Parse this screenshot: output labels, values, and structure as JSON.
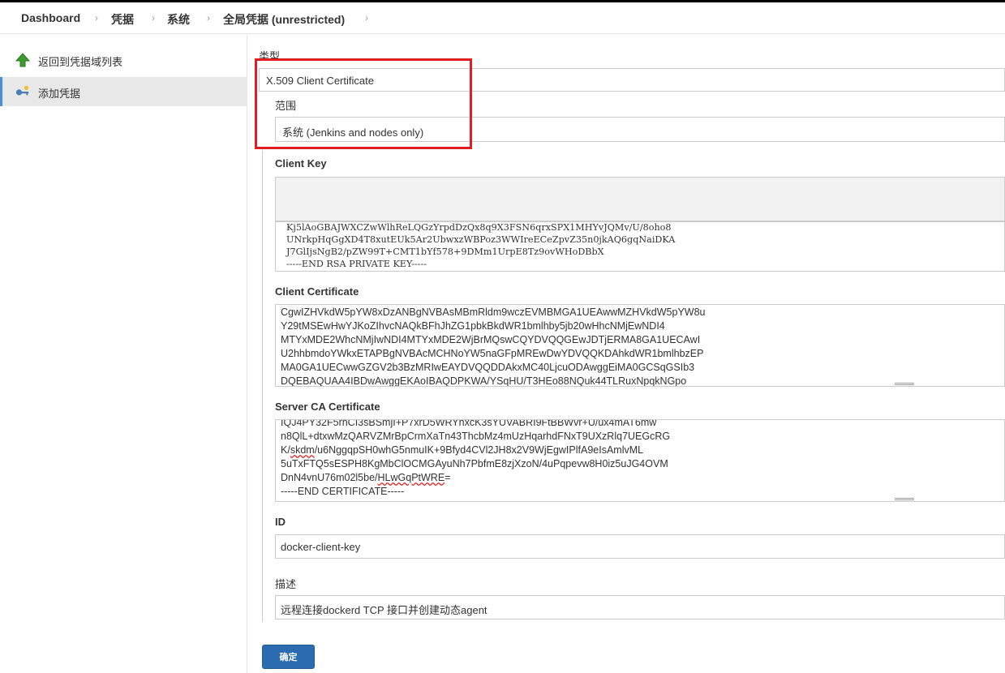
{
  "breadcrumb": {
    "items": [
      "Dashboard",
      "凭据",
      "系统",
      "全局凭据 (unrestricted)"
    ]
  },
  "sidebar": {
    "items": [
      {
        "label": "返回到凭据域列表",
        "icon": "up-arrow-icon"
      },
      {
        "label": "添加凭据",
        "icon": "key-add-icon"
      }
    ]
  },
  "form": {
    "kind_label": "类型",
    "kind_value": "X.509 Client Certificate",
    "scope_label": "范围",
    "scope_value": "系统 (Jenkins and nodes only)",
    "client_key_label": "Client Key",
    "client_key_lines": [
      "Kj5lAoGBAJWXCZwWlhReLQGzYrpdDzQx8q9X3FSN6qrxSPX1MHYvJQMv/U/8oho8",
      "UNrkpHqGgXD4T8xutEUk5Ar2UbwxzWBPoz3WWIreECeZpvZ35n0jkAQ6gqNaiDKA",
      "J7GlIjsNgB2/pZW99T+CMT1bYf578+9DMm1UrpE8Tz9ovWHoDBbX",
      "-----END RSA PRIVATE KEY-----"
    ],
    "client_cert_label": "Client Certificate",
    "client_cert_lines": [
      "CgwIZHVkdW5pYW8xDzANBgNVBAsMBmRldm9wczEVMBMGA1UEAwwMZHVkdW5pYW8u",
      "Y29tMSEwHwYJKoZIhvcNAQkBFhJhZG1pbkBkdWR1bmlhby5jb20wHhcNMjEwNDI4",
      "MTYxMDE2WhcNMjIwNDI4MTYxMDE2WjBrMQswCQYDVQQGEwJDTjERMA8GA1UECAwI",
      "U2hhbmdoYWkxETAPBgNVBAcMCHNoYW5naGFpMREwDwYDVQQKDAhkdWR1bmlhbzEP",
      "MA0GA1UECwwGZGV2b3BzMRIwEAYDVQQDDAkxMC40LjcuODAwggEiMA0GCSqGSIb3",
      "DQEBAQUAA4IBDwAwggEKAoIBAQDPKWA/YSqHU/T3HEo88NQuk44TLRuxNpqkNGpo"
    ],
    "server_ca_label": "Server CA Certificate",
    "server_ca_lines": [
      "IQJ4PY32F5rnCI3sBSmjI+P7xrD5WRYhxcK3sYUVABRI9FtBBWvr+U/ux4mAT6mw",
      "n8QlL+dtxwMzQARVZMrBpCrmXaTn43ThcbMz4mUzHqarhdFNxT9UXzRlq7UEGcRG"
    ],
    "server_ca_skdm_prefix": "K/",
    "server_ca_skdm_word": "skdm",
    "server_ca_skdm_rest": "/u6NggqpSH0whG5nmuIK+9Bfyd4CVl2JH8x2V9WjEgwIPlfA9eIsAmlvML",
    "server_ca_line4": "5uTxFTQ5sESPH8KgMbClOCMGAyuNh7PbfmE8zjXzoN/4uPqpevw8H0iz5uJG4OVM",
    "server_ca_line5_prefix": "DnN4vnU76m02l5be/",
    "server_ca_line5_word": "HLwGqPtWRE",
    "server_ca_line5_suffix": "=",
    "server_ca_end": "-----END CERTIFICATE-----",
    "id_label": "ID",
    "id_value": "docker-client-key",
    "desc_label": "描述",
    "desc_value": "远程连接dockerd TCP 接口并创建动态agent",
    "submit_label": "确定"
  },
  "colors": {
    "accent": "#2b6cb0",
    "highlight_box": "#e02020",
    "active_side_bg": "#e8e8e8"
  }
}
